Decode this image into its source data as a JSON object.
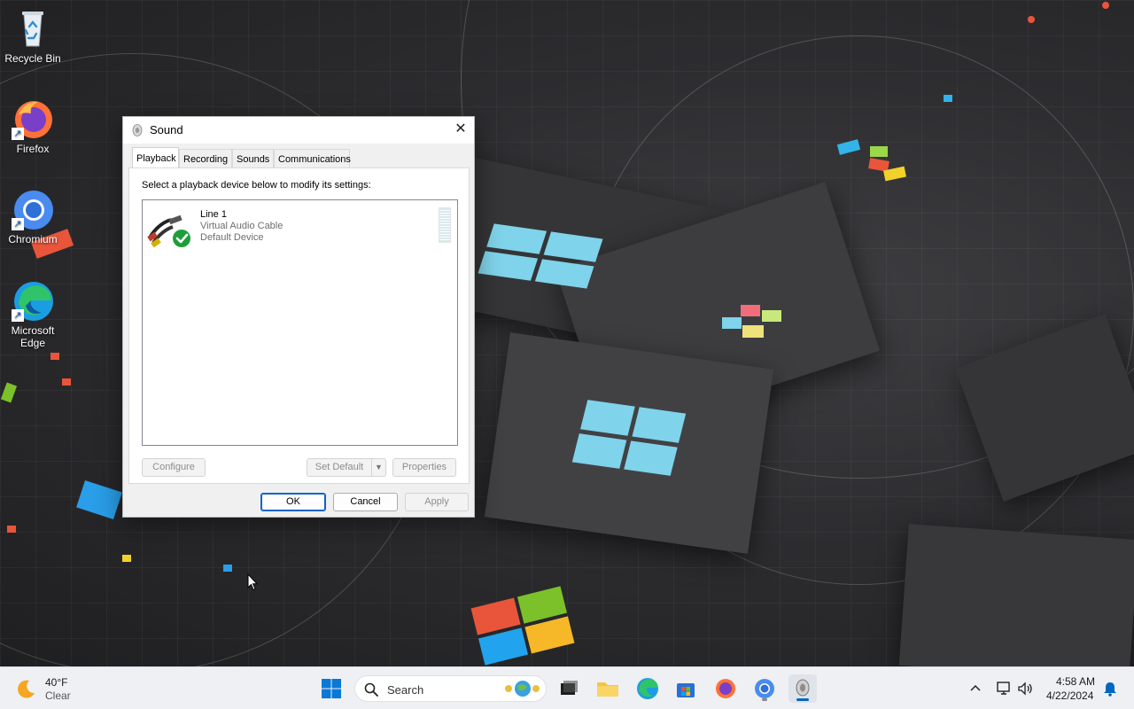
{
  "desktop": {
    "icons": [
      {
        "label": "Recycle Bin"
      },
      {
        "label": "Firefox"
      },
      {
        "label": "Chromium"
      },
      {
        "label": "Microsoft Edge"
      }
    ]
  },
  "dialog": {
    "title": "Sound",
    "close_label": "✕",
    "tabs": [
      {
        "label": "Playback",
        "active": true
      },
      {
        "label": "Recording",
        "active": false
      },
      {
        "label": "Sounds",
        "active": false
      },
      {
        "label": "Communications",
        "active": false
      }
    ],
    "instruction": "Select a playback device below to modify its settings:",
    "devices": [
      {
        "name": "Line 1",
        "description": "Virtual Audio Cable",
        "status": "Default Device"
      }
    ],
    "buttons": {
      "configure": "Configure",
      "set_default": "Set Default",
      "properties": "Properties",
      "ok": "OK",
      "cancel": "Cancel",
      "apply": "Apply"
    }
  },
  "taskbar": {
    "weather": {
      "temp": "40°F",
      "condition": "Clear"
    },
    "search_label": "Search",
    "clock": {
      "time": "4:58 AM",
      "date": "4/22/2024"
    }
  },
  "colors": {
    "accent": "#0067c0",
    "default_button_border": "#0a64c8",
    "check_green": "#1e9e3a"
  }
}
